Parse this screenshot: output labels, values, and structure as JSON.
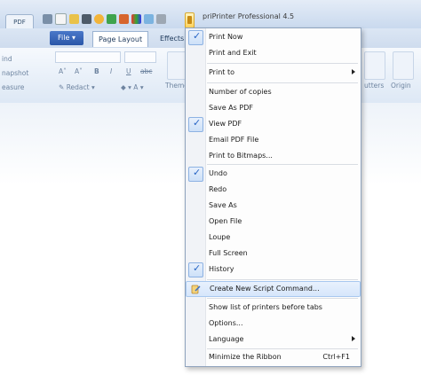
{
  "window": {
    "left_tab": "PDF",
    "app_title": "priPrinter Professional 4.5"
  },
  "tabs": {
    "file": "File",
    "page_layout": "Page Layout",
    "effects": "Effects"
  },
  "ribbon": {
    "left_items": [
      "ind",
      "napshot",
      "easure"
    ],
    "format_buttons": [
      "A˄",
      "A˅",
      "B",
      "I",
      "U",
      "abc"
    ],
    "redact": "Redact",
    "theme_label": "Theme",
    "utters_label": "utters",
    "origin_label": "Origin"
  },
  "menu": {
    "items": [
      {
        "label": "Print Now",
        "checked": true
      },
      {
        "label": "Print and Exit",
        "checked": false
      },
      {
        "label": "Print to",
        "checked": false,
        "submenu": true
      },
      {
        "label": "Number of copies",
        "checked": false
      },
      {
        "label": "Save As PDF",
        "checked": false
      },
      {
        "label": "View PDF",
        "checked": true
      },
      {
        "label": "Email PDF File",
        "checked": false
      },
      {
        "label": "Print to Bitmaps...",
        "checked": false
      },
      {
        "label": "Undo",
        "checked": true
      },
      {
        "label": "Redo",
        "checked": false
      },
      {
        "label": "Save As",
        "checked": false
      },
      {
        "label": "Open File",
        "checked": false
      },
      {
        "label": "Loupe",
        "checked": false
      },
      {
        "label": "Full Screen",
        "checked": false
      },
      {
        "label": "History",
        "checked": true
      },
      {
        "label": "Create New Script Command...",
        "checked": false,
        "highlighted": true
      },
      {
        "label": "Show list of printers before tabs",
        "checked": false
      },
      {
        "label": "Options...",
        "checked": false
      },
      {
        "label": "Language",
        "checked": false,
        "submenu": true
      },
      {
        "label": "Minimize the Ribbon",
        "checked": false,
        "shortcut": "Ctrl+F1"
      }
    ]
  },
  "colors": {
    "accent": "#2865c5",
    "file_button": "#2a56a8",
    "highlight": "#d6e6fb"
  }
}
